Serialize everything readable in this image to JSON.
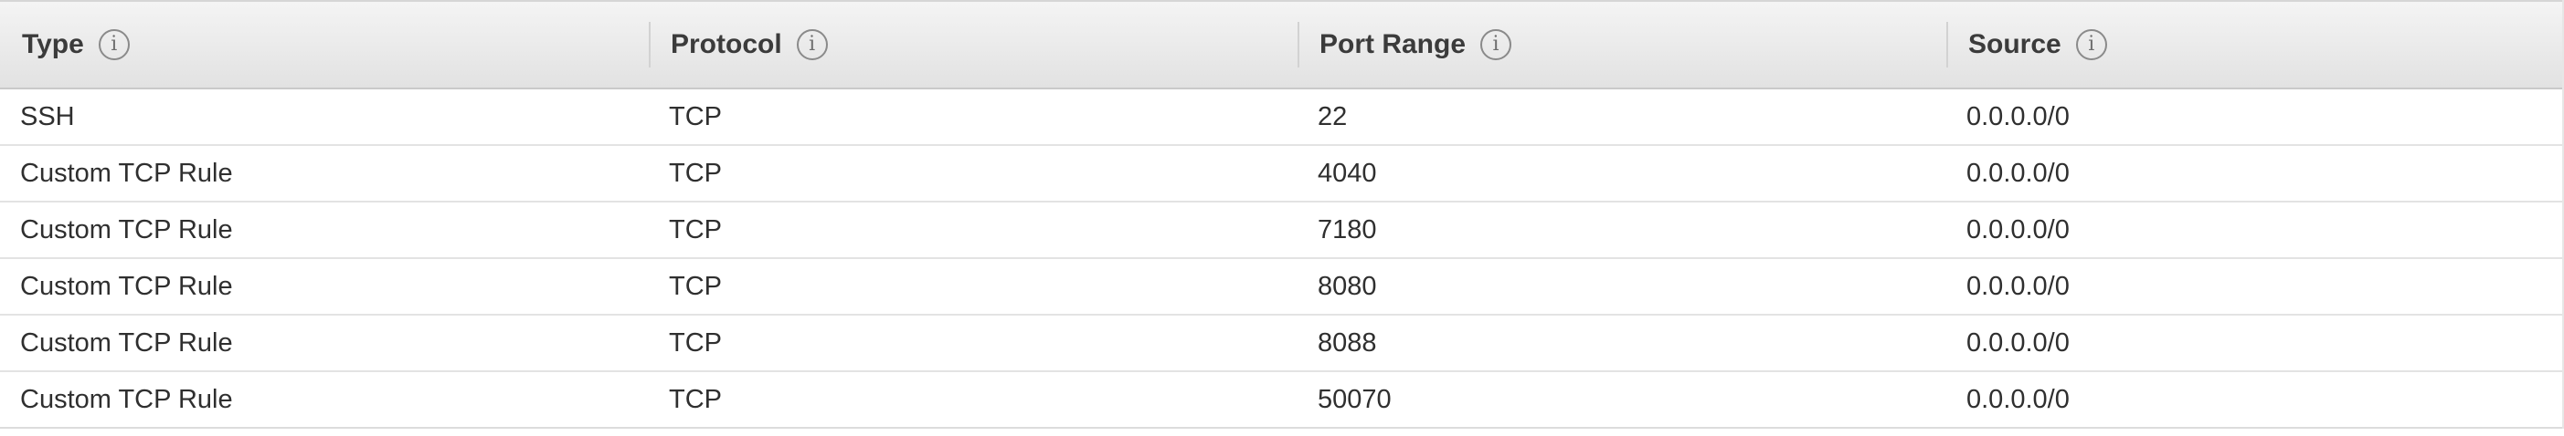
{
  "table": {
    "columns": [
      {
        "label": "Type",
        "info_icon": "info-icon"
      },
      {
        "label": "Protocol",
        "info_icon": "info-icon"
      },
      {
        "label": "Port Range",
        "info_icon": "info-icon"
      },
      {
        "label": "Source",
        "info_icon": "info-icon"
      }
    ],
    "info_glyph": "i",
    "rows": [
      {
        "type": "SSH",
        "protocol": "TCP",
        "port_range": "22",
        "source": "0.0.0.0/0"
      },
      {
        "type": "Custom TCP Rule",
        "protocol": "TCP",
        "port_range": "4040",
        "source": "0.0.0.0/0"
      },
      {
        "type": "Custom TCP Rule",
        "protocol": "TCP",
        "port_range": "7180",
        "source": "0.0.0.0/0"
      },
      {
        "type": "Custom TCP Rule",
        "protocol": "TCP",
        "port_range": "8080",
        "source": "0.0.0.0/0"
      },
      {
        "type": "Custom TCP Rule",
        "protocol": "TCP",
        "port_range": "8088",
        "source": "0.0.0.0/0"
      },
      {
        "type": "Custom TCP Rule",
        "protocol": "TCP",
        "port_range": "50070",
        "source": "0.0.0.0/0"
      }
    ]
  }
}
